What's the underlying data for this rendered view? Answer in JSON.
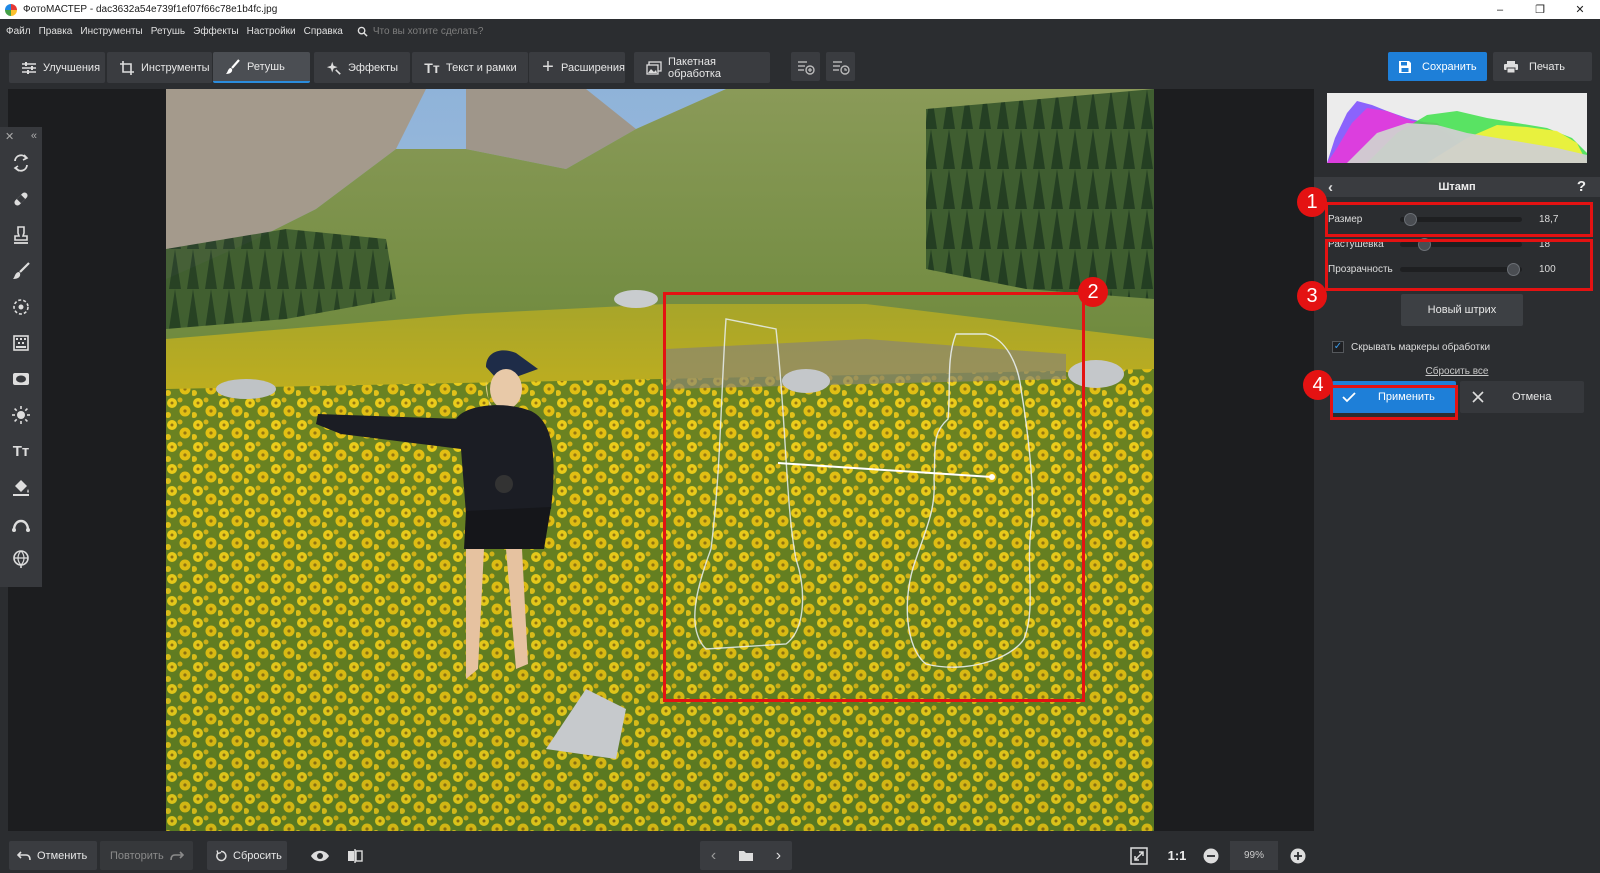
{
  "window": {
    "title": "ФотоМАСТЕР - dac3632a54e739f1ef07f66c78e1b4fc.jpg",
    "controls": [
      "–",
      "❐",
      "✕"
    ]
  },
  "menu": {
    "items": [
      "Файл",
      "Правка",
      "Инструменты",
      "Ретушь",
      "Эффекты",
      "Настройки",
      "Справка"
    ],
    "search_placeholder": "Что вы хотите сделать?"
  },
  "toolbar": {
    "tabs": [
      {
        "label": "Улучшения",
        "icon": "sliders-icon"
      },
      {
        "label": "Инструменты",
        "icon": "crop-icon"
      },
      {
        "label": "Ретушь",
        "icon": "brush-icon",
        "active": true
      },
      {
        "label": "Эффекты",
        "icon": "sparkle-icon"
      },
      {
        "label": "Текст и рамки",
        "icon": "text-icon"
      },
      {
        "label": "Расширения",
        "icon": "plus-icon"
      },
      {
        "label": "Пакетная обработка",
        "icon": "images-icon"
      }
    ],
    "save_label": "Сохранить",
    "print_label": "Печать"
  },
  "stamp_panel": {
    "title": "Штамп",
    "help": "?",
    "sliders": [
      {
        "label": "Размер",
        "value": "18,7",
        "fraction": 0.08
      },
      {
        "label": "Растушевка",
        "value": "18",
        "fraction": 0.2
      },
      {
        "label": "Прозрачность",
        "value": "100",
        "fraction": 0.93
      }
    ],
    "new_stroke_label": "Новый штрих",
    "hide_markers_label": "Скрывать маркеры обработки",
    "hide_markers_checked": true,
    "reset_all_label": "Сбросить все",
    "apply_label": "Применить",
    "cancel_label": "Отмена"
  },
  "annotations": [
    "1",
    "2",
    "3",
    "4"
  ],
  "bottom": {
    "undo_label": "Отменить",
    "redo_label": "Повторить",
    "reset_label": "Сбросить",
    "zoom_ratio": "1:1",
    "zoom_level": "99%"
  },
  "colors": {
    "accent": "#1e7fd8",
    "annotation_red": "#e41212",
    "panel_bg": "#2b2d30"
  }
}
